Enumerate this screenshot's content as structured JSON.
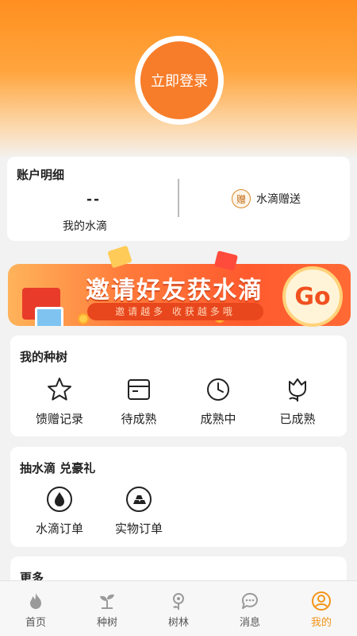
{
  "header": {
    "login_label": "立即登录"
  },
  "account": {
    "title": "账户明细",
    "drops_value": "--",
    "drops_label": "我的水滴",
    "gift_badge": "赠",
    "gift_label": "水滴赠送"
  },
  "banner": {
    "title": "邀请好友获水滴",
    "subtitle": "邀请越多  收获越多哦",
    "go": "Go"
  },
  "my_trees": {
    "title": "我的种树",
    "items": [
      {
        "label": "馈赠记录",
        "icon": "star-icon"
      },
      {
        "label": "待成熟",
        "icon": "box-icon"
      },
      {
        "label": "成熟中",
        "icon": "clock-icon"
      },
      {
        "label": "已成熟",
        "icon": "tulip-icon"
      }
    ]
  },
  "draw": {
    "title": "抽水滴 兑豪礼",
    "items": [
      {
        "label": "水滴订单",
        "icon": "water-drop-icon"
      },
      {
        "label": "实物订单",
        "icon": "gold-bars-icon"
      }
    ]
  },
  "more": {
    "title": "更多"
  },
  "tabs": [
    {
      "label": "首页",
      "icon": "flame-icon",
      "active": false
    },
    {
      "label": "种树",
      "icon": "sprout-icon",
      "active": false
    },
    {
      "label": "树林",
      "icon": "flower-icon",
      "active": false
    },
    {
      "label": "消息",
      "icon": "chat-icon",
      "active": false
    },
    {
      "label": "我的",
      "icon": "user-icon",
      "active": true
    }
  ],
  "colors": {
    "accent": "#f39418",
    "login": "#f77d2a"
  }
}
